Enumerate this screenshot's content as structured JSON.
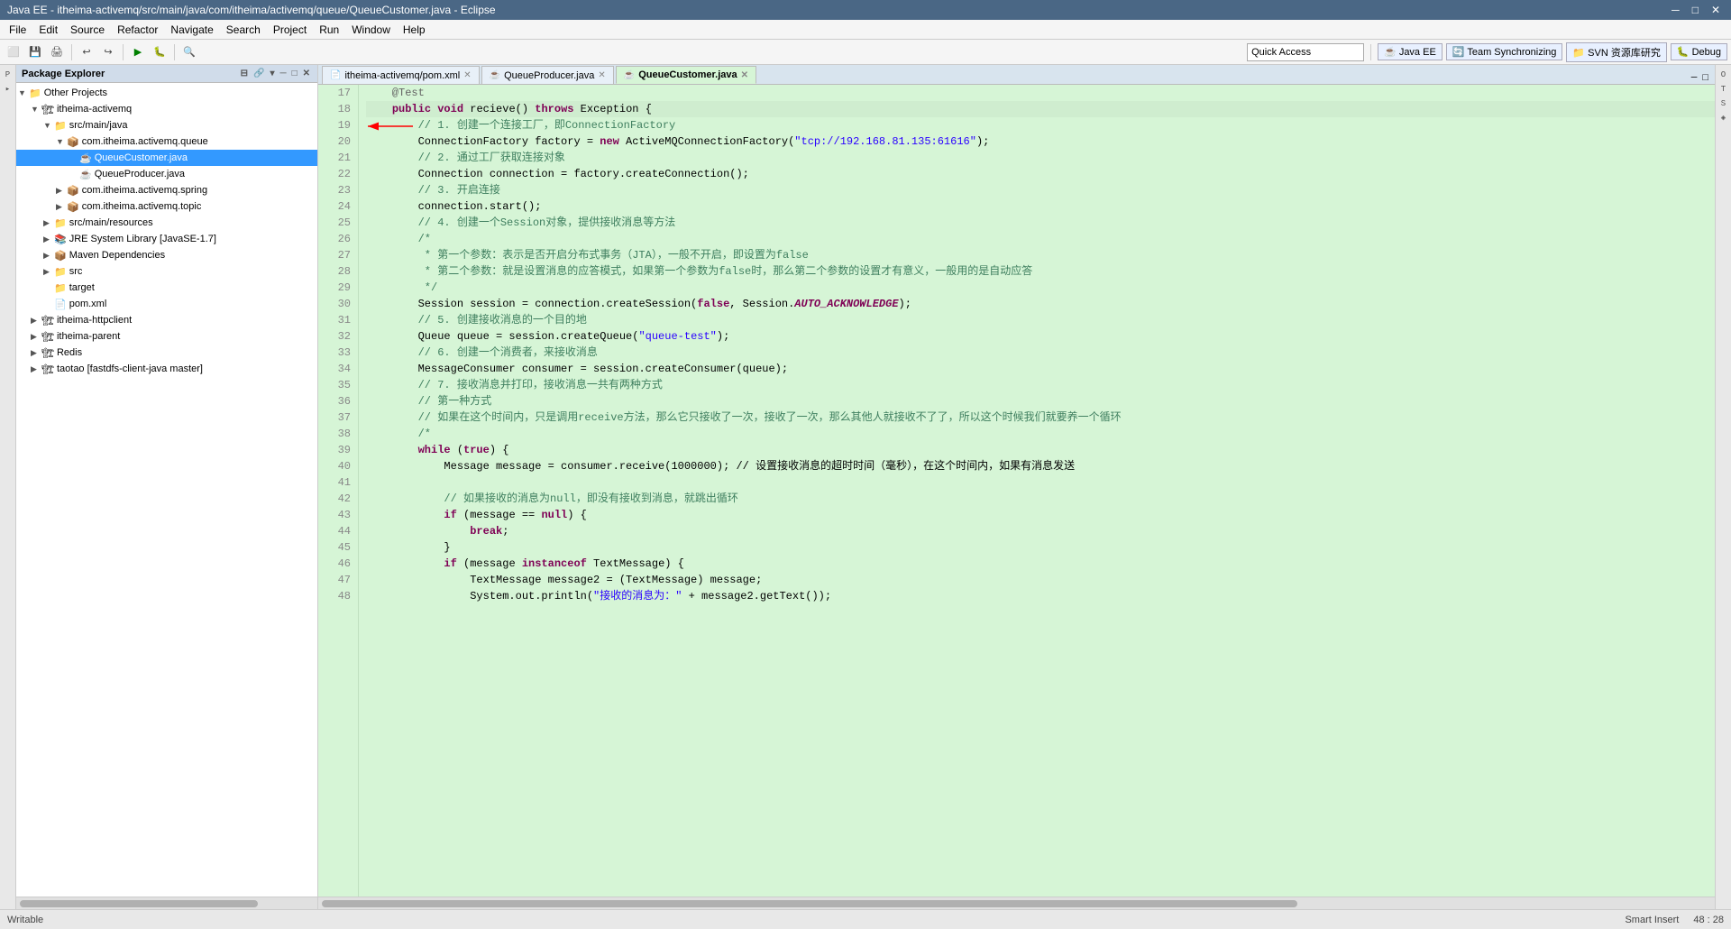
{
  "titleBar": {
    "title": "Java EE - itheima-activemq/src/main/java/com/itheima/activemq/queue/QueueCustomer.java - Eclipse",
    "minimize": "─",
    "maximize": "□",
    "close": "✕"
  },
  "menuBar": {
    "items": [
      "File",
      "Edit",
      "Source",
      "Refactor",
      "Navigate",
      "Search",
      "Project",
      "Run",
      "Window",
      "Help"
    ]
  },
  "toolbar": {
    "quickAccess": {
      "placeholder": "Quick Access",
      "value": "Quick Access"
    },
    "perspectives": [
      "Java EE",
      "Team Synchronizing",
      "SVN 资源库研究",
      "Debug"
    ]
  },
  "packageExplorer": {
    "title": "Package Explorer",
    "tree": [
      {
        "id": 1,
        "indent": 0,
        "arrow": "▼",
        "icon": "📁",
        "label": "Other Projects",
        "type": "folder"
      },
      {
        "id": 2,
        "indent": 1,
        "arrow": "▼",
        "icon": "📦",
        "label": "itheima-activemq",
        "type": "project"
      },
      {
        "id": 3,
        "indent": 2,
        "arrow": "▼",
        "icon": "📁",
        "label": "src/main/java",
        "type": "folder"
      },
      {
        "id": 4,
        "indent": 3,
        "arrow": "▼",
        "icon": "📦",
        "label": "com.itheima.activemq.queue",
        "type": "package"
      },
      {
        "id": 5,
        "indent": 4,
        "arrow": " ",
        "icon": "☕",
        "label": "QueueCustomer.java",
        "type": "file",
        "selected": true
      },
      {
        "id": 6,
        "indent": 4,
        "arrow": " ",
        "icon": "☕",
        "label": "QueueProducer.java",
        "type": "file"
      },
      {
        "id": 7,
        "indent": 3,
        "arrow": "▶",
        "icon": "📦",
        "label": "com.itheima.activemq.spring",
        "type": "package"
      },
      {
        "id": 8,
        "indent": 3,
        "arrow": "▶",
        "icon": "📦",
        "label": "com.itheima.activemq.topic",
        "type": "package"
      },
      {
        "id": 9,
        "indent": 2,
        "arrow": "▶",
        "icon": "📁",
        "label": "src/main/resources",
        "type": "folder"
      },
      {
        "id": 10,
        "indent": 2,
        "arrow": "▶",
        "icon": "☕",
        "label": "JRE System Library [JavaSE-1.7]",
        "type": "library"
      },
      {
        "id": 11,
        "indent": 2,
        "arrow": "▶",
        "icon": "📦",
        "label": "Maven Dependencies",
        "type": "folder"
      },
      {
        "id": 12,
        "indent": 2,
        "arrow": "▶",
        "icon": "📁",
        "label": "src",
        "type": "folder"
      },
      {
        "id": 13,
        "indent": 2,
        "arrow": " ",
        "icon": "📁",
        "label": "target",
        "type": "folder"
      },
      {
        "id": 14,
        "indent": 2,
        "arrow": " ",
        "icon": "📄",
        "label": "pom.xml",
        "type": "file"
      },
      {
        "id": 15,
        "indent": 1,
        "arrow": "▶",
        "icon": "📦",
        "label": "itheima-httpclient",
        "type": "project"
      },
      {
        "id": 16,
        "indent": 1,
        "arrow": "▶",
        "icon": "📦",
        "label": "itheima-parent",
        "type": "project"
      },
      {
        "id": 17,
        "indent": 1,
        "arrow": "▶",
        "icon": "📦",
        "label": "Redis",
        "type": "project"
      },
      {
        "id": 18,
        "indent": 1,
        "arrow": "▶",
        "icon": "📦",
        "label": "taotao  [fastdfs-client-java master]",
        "type": "project"
      }
    ]
  },
  "editor": {
    "tabs": [
      {
        "id": 1,
        "label": "itheima-activemq/pom.xml",
        "active": false,
        "icon": "📄"
      },
      {
        "id": 2,
        "label": "QueueProducer.java",
        "active": false,
        "icon": "☕"
      },
      {
        "id": 3,
        "label": "QueueCustomer.java",
        "active": true,
        "icon": "☕"
      }
    ],
    "lines": [
      {
        "num": 17,
        "content": "    @Test",
        "type": "annotation"
      },
      {
        "num": 18,
        "content": "    public void recieve() throws Exception {",
        "type": "code",
        "highlighted": true
      },
      {
        "num": 19,
        "content": "        // 1. 创建一个连接工厂，即ConnectionFactory",
        "type": "comment"
      },
      {
        "num": 20,
        "content": "        ConnectionFactory factory = new ActiveMQConnectionFactory(\"tcp://192.168.81.135:61616\");",
        "type": "code"
      },
      {
        "num": 21,
        "content": "        // 2. 通过工厂获取连接对象",
        "type": "comment"
      },
      {
        "num": 22,
        "content": "        Connection connection = factory.createConnection();",
        "type": "code"
      },
      {
        "num": 23,
        "content": "        // 3. 开启连接",
        "type": "comment"
      },
      {
        "num": 24,
        "content": "        connection.start();",
        "type": "code"
      },
      {
        "num": 25,
        "content": "        // 4. 创建一个Session对象，提供接收消息等方法",
        "type": "comment"
      },
      {
        "num": 26,
        "content": "        /*",
        "type": "comment"
      },
      {
        "num": 27,
        "content": "         * 第一个参数：表示是否开启分布式事务（JTA），一般不开启，即设置为false",
        "type": "comment"
      },
      {
        "num": 28,
        "content": "         * 第二个参数：就是设置消息的应答模式，如果第一个参数为false时，那么第二个参数的设置才有意义，一般用的是自动应答",
        "type": "comment"
      },
      {
        "num": 29,
        "content": "         */",
        "type": "comment"
      },
      {
        "num": 30,
        "content": "        Session session = connection.createSession(false, Session.AUTO_ACKNOWLEDGE);",
        "type": "code"
      },
      {
        "num": 31,
        "content": "        // 5. 创建接收消息的一个目的地",
        "type": "comment"
      },
      {
        "num": 32,
        "content": "        Queue queue = session.createQueue(\"queue-test\");",
        "type": "code"
      },
      {
        "num": 33,
        "content": "        // 6. 创建一个消费者，来接收消息",
        "type": "comment"
      },
      {
        "num": 34,
        "content": "        MessageConsumer consumer = session.createConsumer(queue);",
        "type": "code"
      },
      {
        "num": 35,
        "content": "        // 7. 接收消息并打印，接收消息一共有两种方式",
        "type": "comment"
      },
      {
        "num": 36,
        "content": "        // 第一种方式",
        "type": "comment"
      },
      {
        "num": 37,
        "content": "        // 如果在这个时间内，只是调用receive方法，那么它只接收了一次，接收了一次，那么其他人就接收不了了，所以这个时候我们就要养一个循环",
        "type": "comment"
      },
      {
        "num": 38,
        "content": "        /*",
        "type": "comment"
      },
      {
        "num": 39,
        "content": "        while (true) {",
        "type": "code"
      },
      {
        "num": 40,
        "content": "            Message message = consumer.receive(1000000); // 设置接收消息的超时时间（毫秒），在这个时间内，如果有消息发送",
        "type": "code"
      },
      {
        "num": 41,
        "content": "",
        "type": "empty"
      },
      {
        "num": 42,
        "content": "            // 如果接收的消息为null，即没有接收到消息，就跳出循环",
        "type": "comment"
      },
      {
        "num": 43,
        "content": "            if (message == null) {",
        "type": "code"
      },
      {
        "num": 44,
        "content": "                break;",
        "type": "code"
      },
      {
        "num": 45,
        "content": "            }",
        "type": "code"
      },
      {
        "num": 46,
        "content": "            if (message instanceof TextMessage) {",
        "type": "code"
      },
      {
        "num": 47,
        "content": "                TextMessage message2 = (TextMessage) message;",
        "type": "code"
      },
      {
        "num": 48,
        "content": "                System.out.println(\"接收的消息为：\" + message2.getText());",
        "type": "code"
      }
    ]
  },
  "statusBar": {
    "writable": "Writable",
    "insertMode": "Smart Insert",
    "position": "48 : 28"
  }
}
